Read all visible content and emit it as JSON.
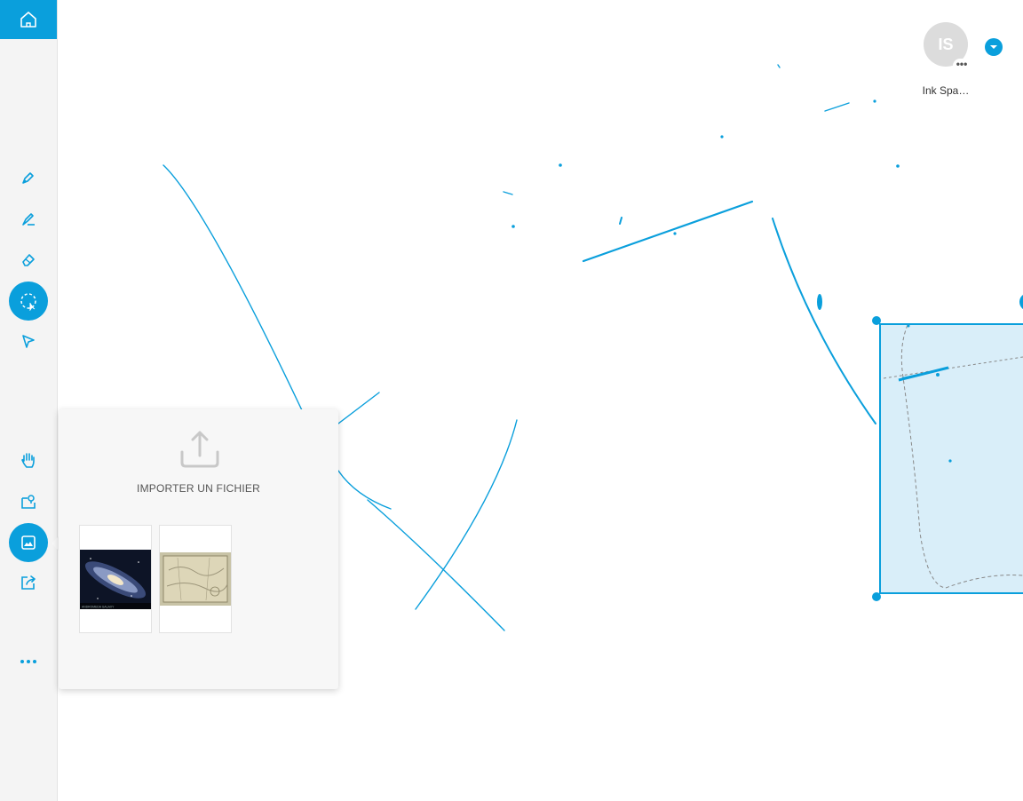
{
  "sidebar": {
    "home": {
      "icon": "home-icon"
    },
    "tools": [
      {
        "name": "pen",
        "icon": "pen-icon",
        "active": false
      },
      {
        "name": "highlighter",
        "icon": "highlighter-icon",
        "active": false
      },
      {
        "name": "eraser",
        "icon": "eraser-icon",
        "active": false
      },
      {
        "name": "lasso-select",
        "icon": "lasso-select-icon",
        "active": true
      },
      {
        "name": "pointer",
        "icon": "pointer-icon",
        "active": false
      },
      {
        "name": "hand",
        "icon": "hand-icon",
        "active": false
      },
      {
        "name": "sticky",
        "icon": "sticky-note-icon",
        "active": false
      },
      {
        "name": "image",
        "icon": "image-icon",
        "active": true
      },
      {
        "name": "share",
        "icon": "share-icon",
        "active": false
      },
      {
        "name": "more",
        "icon": "more-icon",
        "active": false
      }
    ]
  },
  "user": {
    "initials": "IS",
    "name": "Ink Spa…",
    "more": "•••"
  },
  "import_panel": {
    "label": "IMPORTER UN FICHIER",
    "thumbnails": [
      {
        "icon": "galaxy-image",
        "caption": "ANDROMEDA GALAXY"
      },
      {
        "icon": "old-map-image"
      }
    ]
  },
  "colors": {
    "accent": "#0a9fdc",
    "sidebar_bg": "#f4f4f4",
    "selection_fill": "#d9eef9"
  }
}
